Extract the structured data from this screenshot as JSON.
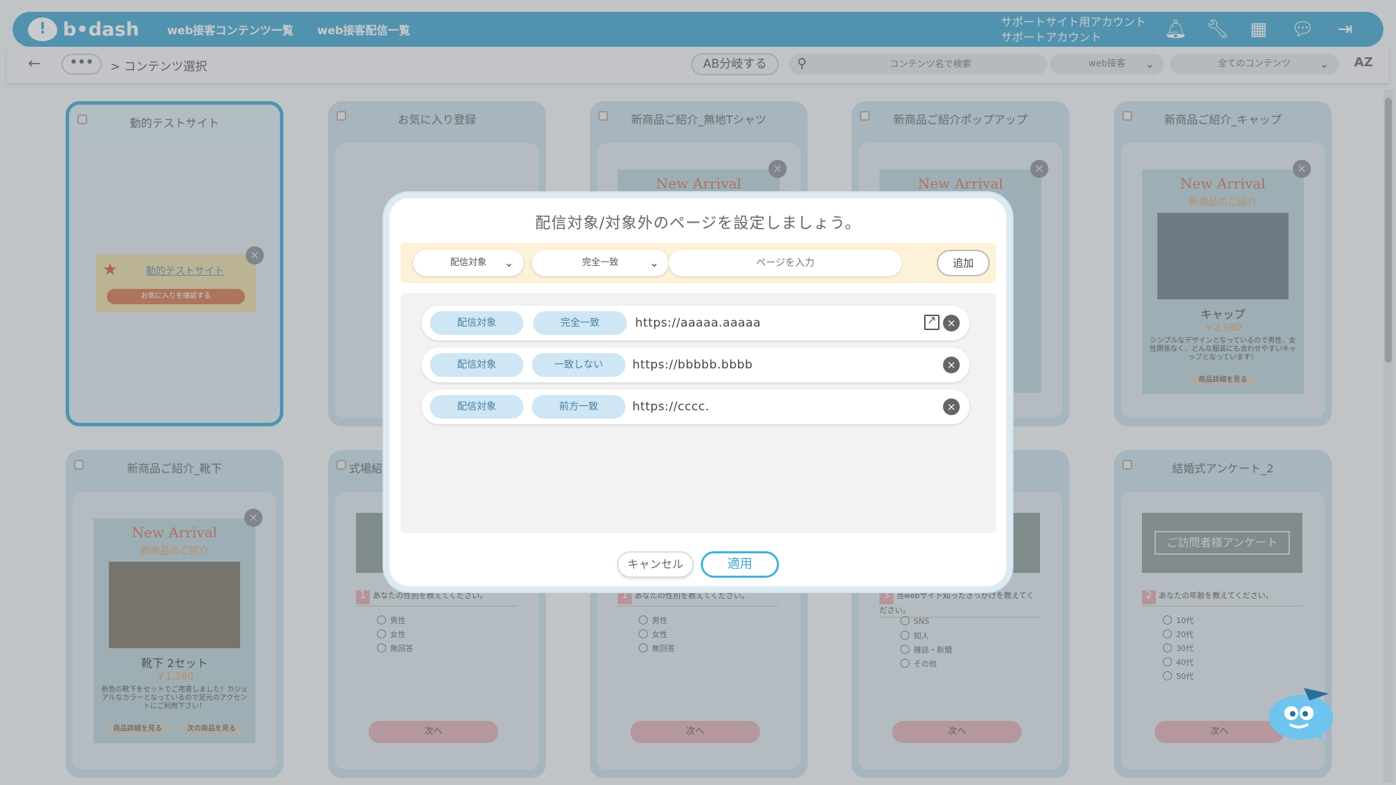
{
  "header": {
    "logo_text": "b•dash",
    "nav": [
      "web接客コンテンツ一覧",
      "web接客配信一覧"
    ],
    "account_line1": "サポートサイト用アカウント",
    "account_line2": "サポートアカウント"
  },
  "toolbar": {
    "more": "•••",
    "breadcrumb": "> コンテンツ選択",
    "ab_button": "AB分岐する",
    "search_placeholder": "コンテンツ名で検索",
    "type_select": "web接客",
    "filter_select": "全てのコンテンツ",
    "sort": "AZ"
  },
  "cards": [
    {
      "title": "動的テストサイト",
      "fav_link": "動的テストサイト",
      "fav_button": "お気に入りを確認する"
    },
    {
      "title": "お気に入り登録"
    },
    {
      "title": "新商品ご紹介_無地Tシャツ",
      "promo_title": "New Arrival"
    },
    {
      "title": "新商品ご紹介ポップアップ",
      "promo_title": "New Arrival"
    },
    {
      "title": "新商品ご紹介_キャップ",
      "promo_title": "New Arrival",
      "promo_sub": "新商品のご紹介",
      "name": "キャップ",
      "price": "￥2,980",
      "desc": "シンプルなデザインとなっているので男性、女性関係なく、どんな服装にも合わせやすいキャップとなっています！",
      "detail_btn": "商品詳細を見る"
    },
    {
      "title": "新商品ご紹介_靴下",
      "promo_title": "New Arrival",
      "promo_sub": "新商品のご紹介",
      "name": "靴下 2セット",
      "price": "￥1,280",
      "desc": "新色の靴下をセットでご用意しました！カジュアルなカラーとなっているので足元のアクセントにご利用下さい！",
      "detail_btn": "商品詳細を見る",
      "next_btn": "次の商品を見る"
    },
    {
      "title": "式場紹",
      "question": "あなたの性別を教えてください。",
      "qnum": "1",
      "options": [
        "男性",
        "女性",
        "無回答"
      ],
      "next": "次へ"
    },
    {
      "title": "",
      "question": "あなたの性別を教えてください。",
      "qnum": "1",
      "options": [
        "男性",
        "女性",
        "無回答"
      ],
      "next": "次へ"
    },
    {
      "title": "",
      "question": "当webサイト知ったきっかけを教えてください。",
      "qnum": "3",
      "options": [
        "SNS",
        "知人",
        "雑誌・新聞",
        "その他"
      ],
      "next": "次へ"
    },
    {
      "title": "結婚式アンケート_2",
      "banner": "ご訪問者様アンケート",
      "question": "あなたの年齢を教えてください。",
      "qnum": "2",
      "options": [
        "10代",
        "20代",
        "30代",
        "40代",
        "50代"
      ],
      "next": "次へ"
    }
  ],
  "modal": {
    "title": "配信対象/対象外のページを設定しましょう。",
    "target_select": "配信対象",
    "match_select": "完全一致",
    "page_placeholder": "ページを入力",
    "add_button": "追加",
    "rules": [
      {
        "target": "配信対象",
        "match": "完全一致",
        "url": "https://aaaaa.aaaaa"
      },
      {
        "target": "配信対象",
        "match": "一致しない",
        "url": "https://bbbbb.bbbb"
      },
      {
        "target": "配信対象",
        "match": "前方一致",
        "url": "https://cccc."
      }
    ],
    "cancel_button": "キャンセル",
    "apply_button": "適用"
  },
  "colors": {
    "brand": "#3fa6cf",
    "tag_bg": "#cfe6f4",
    "add_bar": "#fdf1d8"
  }
}
